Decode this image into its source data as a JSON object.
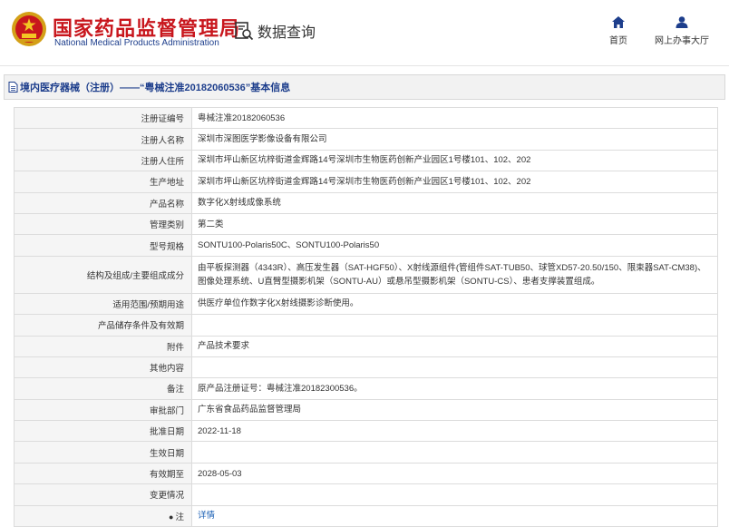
{
  "header": {
    "site_name_cn": "国家药品监督管理局",
    "site_name_en": "National Medical Products Administration",
    "query_label": "数据查询",
    "nav": [
      {
        "label": "首页",
        "icon": "home-icon"
      },
      {
        "label": "网上办事大厅",
        "icon": "user-icon"
      }
    ]
  },
  "page": {
    "title": "境内医疗器械（注册）——“粤械注准20182060536”基本信息"
  },
  "rows": [
    {
      "label": "注册证编号",
      "value": "粤械注准20182060536"
    },
    {
      "label": "注册人名称",
      "value": "深圳市深图医学影像设备有限公司"
    },
    {
      "label": "注册人住所",
      "value": "深圳市坪山新区坑梓街道金辉路14号深圳市生物医药创新产业园区1号楼101、102、202"
    },
    {
      "label": "生产地址",
      "value": "深圳市坪山新区坑梓街道金辉路14号深圳市生物医药创新产业园区1号楼101、102、202"
    },
    {
      "label": "产品名称",
      "value": "数字化X射线成像系统"
    },
    {
      "label": "管理类别",
      "value": "第二类"
    },
    {
      "label": "型号规格",
      "value": "SONTU100-Polaris50C、SONTU100-Polaris50"
    },
    {
      "label": "结构及组成/主要组成成分",
      "value": "由平板探测器（4343R）、高压发生器（SAT-HGF50）、X射线源组件(管组件SAT-TUB50、球管XD57-20.50/150、限束器SAT-CM38)、图像处理系统、U直臂型摄影机架（SONTU-AU）或悬吊型摄影机架（SONTU-CS）、患者支撑装置组成。"
    },
    {
      "label": "适用范围/预期用途",
      "value": "供医疗单位作数字化X射线摄影诊断使用。"
    },
    {
      "label": "产品储存条件及有效期",
      "value": ""
    },
    {
      "label": "附件",
      "value": "产品技术要求"
    },
    {
      "label": "其他内容",
      "value": ""
    },
    {
      "label": "备注",
      "value": "原产品注册证号：粤械注准20182300536。"
    },
    {
      "label": "审批部门",
      "value": "广东省食品药品监督管理局"
    },
    {
      "label": "批准日期",
      "value": "2022-11-18"
    },
    {
      "label": "生效日期",
      "value": ""
    },
    {
      "label": "有效期至",
      "value": "2028-05-03"
    },
    {
      "label": "变更情况",
      "value": ""
    },
    {
      "label": "注",
      "value": "详情",
      "icon": "pin-icon"
    }
  ],
  "colors": {
    "brand_red": "#c8161d",
    "brand_blue": "#1d3e8c",
    "link_blue": "#1a5fb4"
  }
}
